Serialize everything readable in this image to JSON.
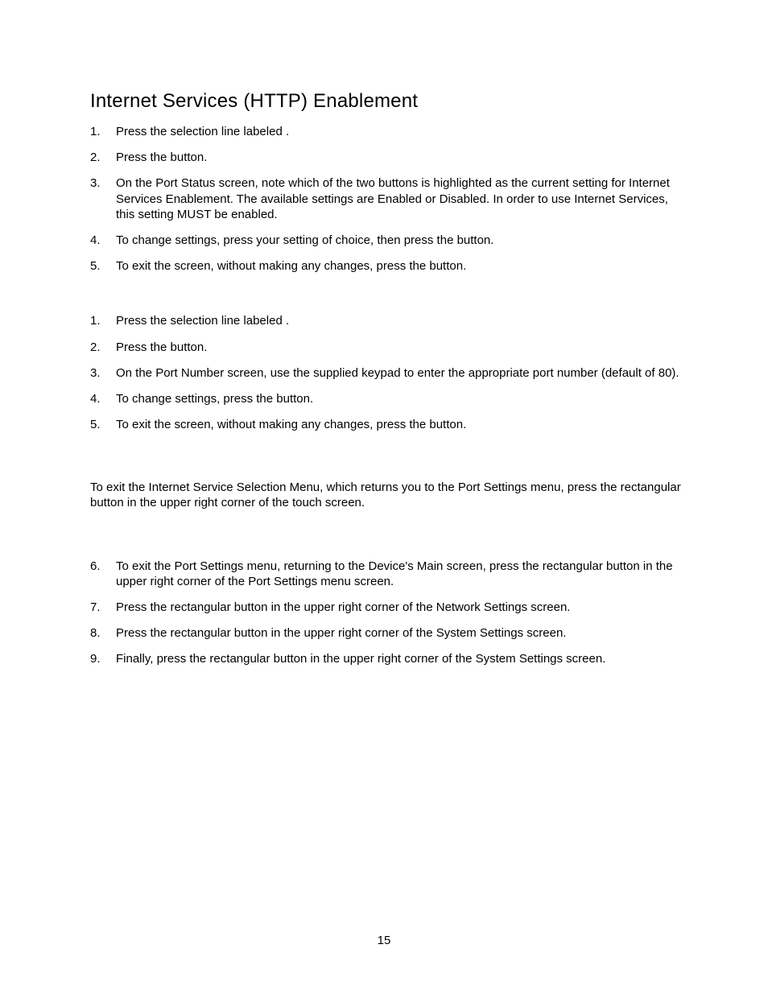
{
  "heading": "Internet Services (HTTP) Enablement",
  "listA": [
    {
      "n": "1.",
      "t": "Press the selection line labeled                                 ."
    },
    {
      "n": "2.",
      "t": "Press the                               button."
    },
    {
      "n": "3.",
      "t": "On the Port Status screen, note which of the two buttons is highlighted as the current setting for Internet Services Enablement.  The available settings are Enabled or Disabled.  In order to use Internet Services, this setting MUST be enabled."
    },
    {
      "n": "4.",
      "t": "To change settings, press your setting of choice, then press the           button."
    },
    {
      "n": "5.",
      "t": "To exit the screen, without making any changes, press the              button."
    }
  ],
  "listB": [
    {
      "n": "1.",
      "t": "Press the selection line labeled                                 ."
    },
    {
      "n": "2.",
      "t": "Press the                               button."
    },
    {
      "n": "3.",
      "t": "On the Port Number screen, use the supplied keypad to enter the appropriate port number (default of 80)."
    },
    {
      "n": "4.",
      "t": "To change settings, press the            button."
    },
    {
      "n": "5.",
      "t": "To exit the screen, without making any changes, press the              button."
    }
  ],
  "midPara": "To exit the Internet Service Selection Menu, which returns you to the Port Settings menu, press the rectangular              button in the upper right corner of the touch screen.",
  "listC": [
    {
      "n": "6.",
      "t": "To exit the Port Settings menu, returning to the Device's Main screen, press the rectangular button in the upper right corner of the Port Settings menu screen."
    },
    {
      "n": "7.",
      "t": "Press the rectangular            button in the upper right corner of the Network Settings screen."
    },
    {
      "n": "8.",
      "t": "Press the rectangular            button in the upper right corner of the System Settings screen."
    },
    {
      "n": "9.",
      "t": "Finally, press the rectangular          button in the upper right corner of the System Settings screen."
    }
  ],
  "pageNumber": "15"
}
